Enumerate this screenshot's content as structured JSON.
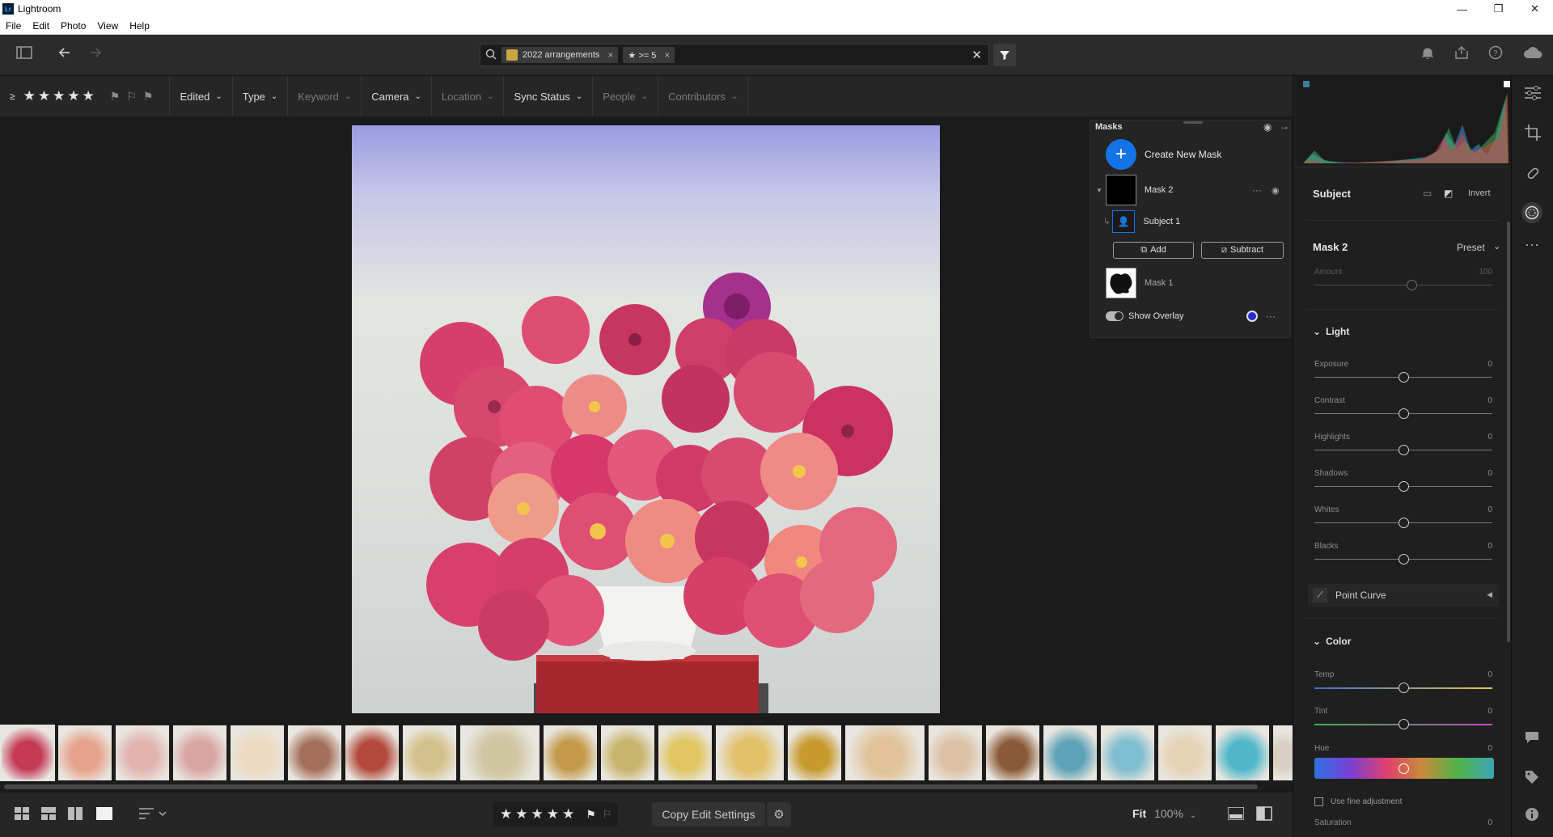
{
  "app": {
    "title": "Lightroom",
    "logo": "Lr"
  },
  "window_controls": {
    "minimize": "—",
    "restore": "❐",
    "close": "✕"
  },
  "menu": [
    "File",
    "Edit",
    "Photo",
    "View",
    "Help"
  ],
  "search": {
    "chips": [
      {
        "label": "2022 arrangements",
        "close": "×"
      },
      {
        "label": "★ >= 5",
        "close": "×"
      }
    ],
    "clear": "✕"
  },
  "filterbar": {
    "rating_prefix": "≥",
    "stars": "★★★★★",
    "flags": "⚑⚐⚑",
    "dropdowns": [
      {
        "label": "Edited",
        "enabled": true
      },
      {
        "label": "Type",
        "enabled": true
      },
      {
        "label": "Keyword",
        "enabled": false
      },
      {
        "label": "Camera",
        "enabled": true
      },
      {
        "label": "Location",
        "enabled": false
      },
      {
        "label": "Sync Status",
        "enabled": true
      },
      {
        "label": "People",
        "enabled": false
      },
      {
        "label": "Contributors",
        "enabled": false
      }
    ]
  },
  "masks_panel": {
    "title": "Masks",
    "create_label": "Create New Mask",
    "mask2_label": "Mask 2",
    "subject_label": "Subject 1",
    "add_label": "Add",
    "subtract_label": "Subtract",
    "mask1_label": "Mask 1",
    "overlay_label": "Show Overlay"
  },
  "bottombar": {
    "copy_label": "Copy Edit Settings",
    "stars": "★★★★★",
    "fit_label": "Fit",
    "zoom_pct": "100%"
  },
  "right_panel": {
    "subject_header": "Subject",
    "invert_label": "Invert",
    "mask_name": "Mask 2",
    "preset_label": "Preset",
    "amount_label": "Amount",
    "amount_val": "100",
    "light_header": "Light",
    "light_sliders": [
      {
        "label": "Exposure",
        "val": "0"
      },
      {
        "label": "Contrast",
        "val": "0"
      },
      {
        "label": "Highlights",
        "val": "0"
      },
      {
        "label": "Shadows",
        "val": "0"
      },
      {
        "label": "Whites",
        "val": "0"
      },
      {
        "label": "Blacks",
        "val": "0"
      }
    ],
    "point_curve_label": "Point Curve",
    "color_header": "Color",
    "temp_label": "Temp",
    "temp_val": "0",
    "tint_label": "Tint",
    "tint_val": "0",
    "hue_label": "Hue",
    "hue_val": "0",
    "fine_adjust_label": "Use fine adjustment",
    "saturation_label": "Saturation",
    "saturation_val": "0"
  },
  "filmstrip_colors": [
    "#c43a55",
    "#e7a28c",
    "#e3b3b0",
    "#d9a5a2",
    "#eddac0",
    "#a46f5a",
    "#b3493c",
    "#d4c08a",
    "#cfc6a2",
    "#c49a4a",
    "#c9b46d",
    "#e0c560",
    "#e2c16a",
    "#c79a2e",
    "#e1c39a",
    "#ddc1a6",
    "#8a5a38",
    "#5fa2b8",
    "#7fbdd0",
    "#e6d2b5",
    "#4fb7c9",
    "#d9cfc3"
  ],
  "colors": {
    "accent": "#1473e6",
    "panel": "#1f1f1f"
  }
}
